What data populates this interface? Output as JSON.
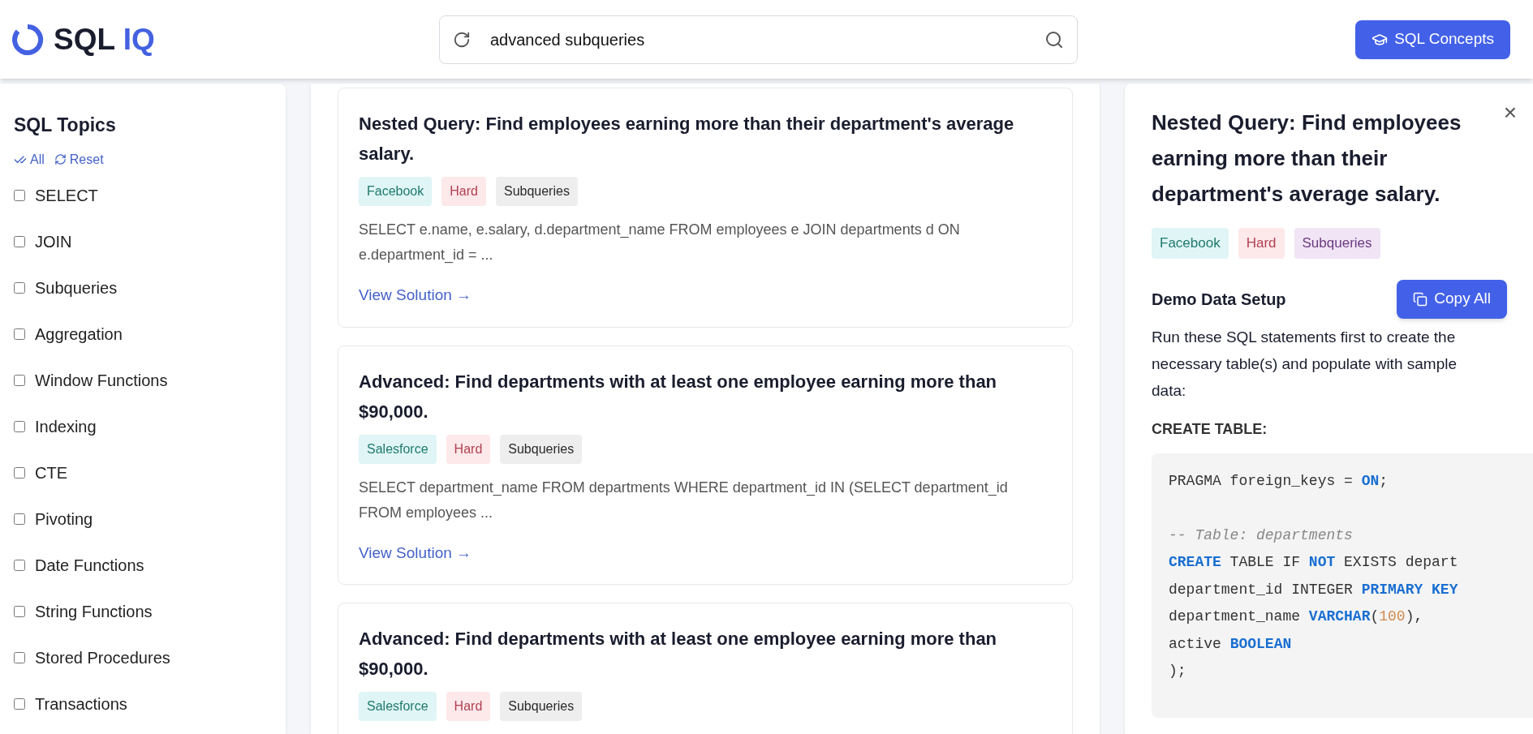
{
  "header": {
    "logo": {
      "text": "SQL",
      "accent": "IQ"
    },
    "search": {
      "value": "advanced subqueries"
    },
    "concepts_button": "SQL Concepts"
  },
  "sidebar": {
    "title": "SQL Topics",
    "actions": [
      "All",
      "Reset"
    ],
    "topics": [
      {
        "label": "SELECT",
        "checked": false
      },
      {
        "label": "JOIN",
        "checked": false
      },
      {
        "label": "Subqueries",
        "checked": false
      },
      {
        "label": "Aggregation",
        "checked": false
      },
      {
        "label": "Window Functions",
        "checked": false
      },
      {
        "label": "Indexing",
        "checked": false
      },
      {
        "label": "CTE",
        "checked": false
      },
      {
        "label": "Pivoting",
        "checked": false
      },
      {
        "label": "Date Functions",
        "checked": false
      },
      {
        "label": "String Functions",
        "checked": false
      },
      {
        "label": "Stored Procedures",
        "checked": false
      },
      {
        "label": "Transactions",
        "checked": false
      }
    ]
  },
  "results": [
    {
      "title": "Nested Query: Find employees earning more than their department's average salary.",
      "tags": [
        {
          "text": "Facebook",
          "kind": "company"
        },
        {
          "text": "Hard",
          "kind": "difficulty"
        },
        {
          "text": "Subqueries",
          "kind": "topic"
        }
      ],
      "snippet": "SELECT e.name, e.salary, d.department_name FROM employees e JOIN departments d ON e.department_id = ...",
      "link": "View Solution →"
    },
    {
      "title": "Advanced: Find departments with at least one employee earning more than $90,000.",
      "tags": [
        {
          "text": "Salesforce",
          "kind": "company"
        },
        {
          "text": "Hard",
          "kind": "difficulty"
        },
        {
          "text": "Subqueries",
          "kind": "topic"
        }
      ],
      "snippet": "SELECT department_name FROM departments WHERE department_id IN (SELECT department_id FROM employees ...",
      "link": "View Solution →"
    },
    {
      "title": "Advanced: Find departments with at least one employee earning more than $90,000.",
      "tags": [
        {
          "text": "Salesforce",
          "kind": "company"
        },
        {
          "text": "Hard",
          "kind": "difficulty"
        },
        {
          "text": "Subqueries",
          "kind": "topic"
        }
      ]
    }
  ],
  "detail": {
    "close": "×",
    "title": "Nested Query: Find employees earning more than their department's average salary.",
    "tags": [
      {
        "text": "Facebook",
        "kind": "company"
      },
      {
        "text": "Hard",
        "kind": "difficulty"
      },
      {
        "text": "Subqueries",
        "kind": "topic-accent"
      }
    ],
    "section_title": "Demo Data Setup",
    "copy_button": "Copy All",
    "description": "Run these SQL statements first to create the necessary table(s) and populate with sample data:",
    "code_heading": "CREATE TABLE:",
    "code_lines": [
      [
        {
          "text": "PRAGMA foreign_keys = ",
          "kind": "plain"
        },
        {
          "text": "ON",
          "kind": "keyword"
        },
        {
          "text": ";",
          "kind": "plain"
        }
      ],
      {
        "kind": "blank"
      },
      [
        {
          "text": "-- Table: departments",
          "kind": "comment"
        }
      ],
      [
        {
          "text": "CREATE",
          "kind": "keyword"
        },
        {
          "text": " TABLE IF ",
          "kind": "plain"
        },
        {
          "text": "NOT",
          "kind": "keyword"
        },
        {
          "text": " EXISTS depart",
          "kind": "plain"
        }
      ],
      [
        {
          "text": "department_id INTEGER ",
          "kind": "plain"
        },
        {
          "text": "PRIMARY KEY",
          "kind": "keyword"
        }
      ],
      [
        {
          "text": "department_name ",
          "kind": "plain"
        },
        {
          "text": "VARCHAR",
          "kind": "keyword"
        },
        {
          "text": "(",
          "kind": "plain"
        },
        {
          "text": "100",
          "kind": "number"
        },
        {
          "text": "),",
          "kind": "plain"
        }
      ],
      [
        {
          "text": "active ",
          "kind": "plain"
        },
        {
          "text": "BOOLEAN",
          "kind": "keyword"
        }
      ],
      [
        {
          "text": ");",
          "kind": "plain"
        }
      ]
    ]
  }
}
